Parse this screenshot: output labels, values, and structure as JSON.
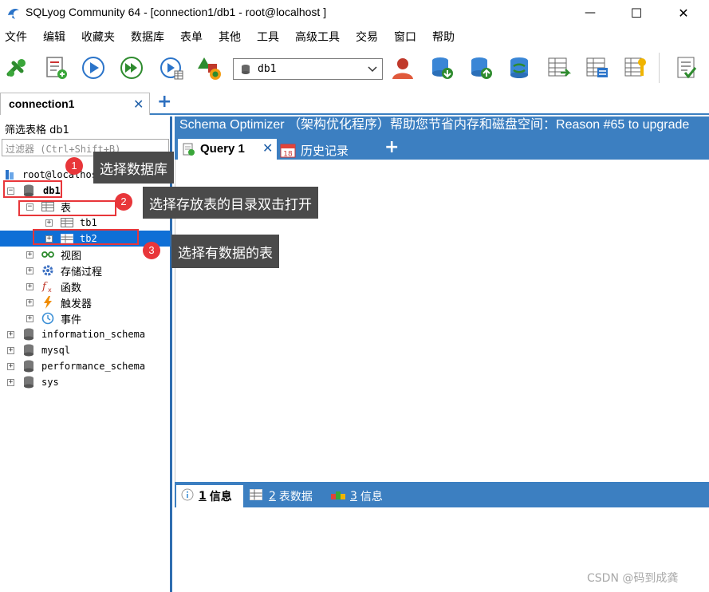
{
  "window": {
    "title": "SQLyog Community 64 - [connection1/db1 - root@localhost ]",
    "min_glyph": "—",
    "max_glyph": "☐",
    "close_glyph": "✕"
  },
  "menu": [
    "文件",
    "编辑",
    "收藏夹",
    "数据库",
    "表单",
    "其他",
    "工具",
    "高级工具",
    "交易",
    "窗口",
    "帮助"
  ],
  "toolbar": {
    "db_selector_value": "db1",
    "buttons": [
      "new-connection-icon",
      "new-query-icon",
      "execute-icon",
      "execute-all-icon",
      "execute-edit-icon",
      "schema-designer-icon",
      "user-manager-icon",
      "backup-icon",
      "restore-icon",
      "sync-icon",
      "import-table-icon",
      "export-table-icon",
      "schema-sync-icon",
      "query-profiler-icon"
    ]
  },
  "connection_tab": {
    "label": "connection1",
    "close": "✕",
    "add": "+"
  },
  "left_panel": {
    "filter_label": "筛选表格 db1",
    "filter_placeholder": "过滤器 (Ctrl+Shift+B)",
    "tree": {
      "root": "root@localhost",
      "db1": "db1",
      "tables": "表",
      "tb1": "tb1",
      "tb2": "tb2",
      "views": "视图",
      "procs": "存储过程",
      "funcs": "函数",
      "triggers": "触发器",
      "events": "事件",
      "information_schema": "information_schema",
      "mysql": "mysql",
      "performance_schema": "performance_schema",
      "sys": "sys"
    }
  },
  "banner": "Schema Optimizer （架构优化程序）帮助您节省内存和磁盘空间：Reason #65 to upgrade",
  "query_tabs": {
    "active": "Query 1",
    "close": "✕",
    "history": "历史记录",
    "add": "+",
    "history_day": "18"
  },
  "result_tabs": [
    {
      "num": "1",
      "label": "信息"
    },
    {
      "num": "2",
      "label": "表数据"
    },
    {
      "num": "3",
      "label": "信息"
    }
  ],
  "annotations": {
    "step1_num": "1",
    "step1_text": "选择数据库",
    "step2_num": "2",
    "step2_text": "选择存放表的目录双击打开",
    "step3_num": "3",
    "step3_text": "选择有数据的表"
  },
  "watermark": "CSDN @码到成龚",
  "colors": {
    "accent": "#3c7fc1",
    "selection": "#0f6fd6",
    "annotation": "#e8363a",
    "callout": "#4a4a4a"
  }
}
